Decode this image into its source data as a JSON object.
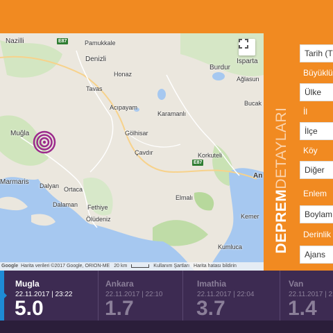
{
  "map": {
    "places": {
      "nazilli": "Nazilli",
      "pamukkale": "Pamukkale",
      "denizli": "Denizli",
      "honaz": "Honaz",
      "tavas": "Tavas",
      "acipayam": "Acıpayam",
      "karamanli": "Karamanlı",
      "mugla": "Muğla",
      "golhisar": "Gölhisar",
      "cavdir": "Çavdır",
      "korkuteli": "Korkuteli",
      "burdur": "Burdur",
      "isparta": "Isparta",
      "aglasun": "Ağlasun",
      "bucak": "Bucak",
      "marmaris": "Marmaris",
      "dalyan": "Dalyan",
      "ortaca": "Ortaca",
      "dalaman": "Dalaman",
      "fethiye": "Fethiye",
      "oludeniz": "Ölüdeniz",
      "elmali": "Elmalı",
      "kemer": "Kemer",
      "kumluca": "Kumluca",
      "antalya_partial": "An"
    },
    "roads": {
      "e87_north": "E87",
      "e87_south": "E87"
    },
    "attribution": {
      "google": "Google",
      "data": "Harita verileri ©2017 Google, ORION-ME",
      "scale": "20 km",
      "terms": "Kullanım Şartları",
      "report": "Harita hatası bildirin"
    }
  },
  "sidebar": {
    "title_bold": "DEPREM",
    "title_thin": "DETAYLARI",
    "fields": [
      {
        "type": "input",
        "value": "Tarih (T"
      },
      {
        "type": "label",
        "value": "Büyüklü"
      },
      {
        "type": "input",
        "value": "Ülke"
      },
      {
        "type": "label",
        "value": "İl"
      },
      {
        "type": "input",
        "value": "İlçe"
      },
      {
        "type": "label",
        "value": "Köy"
      },
      {
        "type": "input",
        "value": "Diğer"
      },
      {
        "type": "label",
        "value": "Enlem"
      },
      {
        "type": "input",
        "value": "Boylam"
      },
      {
        "type": "label",
        "value": "Derinlik"
      },
      {
        "type": "input",
        "value": "Ajans"
      }
    ]
  },
  "earthquakes": [
    {
      "city": "Mugla",
      "datetime": "22.11.2017 | 23:22",
      "magnitude": "5.0",
      "active": true
    },
    {
      "city": "Ankara",
      "datetime": "22.11.2017 | 22:10",
      "magnitude": "1.7",
      "active": false
    },
    {
      "city": "Imathia",
      "datetime": "22.11.2017 | 22:04",
      "magnitude": "3.7",
      "active": false
    },
    {
      "city": "Van",
      "datetime": "22.11.2017 | 21:56",
      "magnitude": "1.4",
      "active": false
    }
  ],
  "colors": {
    "accent": "#f18a21",
    "footer": "#3d2b52",
    "marker": "#9c2a8c",
    "water": "#a6c8f0"
  }
}
